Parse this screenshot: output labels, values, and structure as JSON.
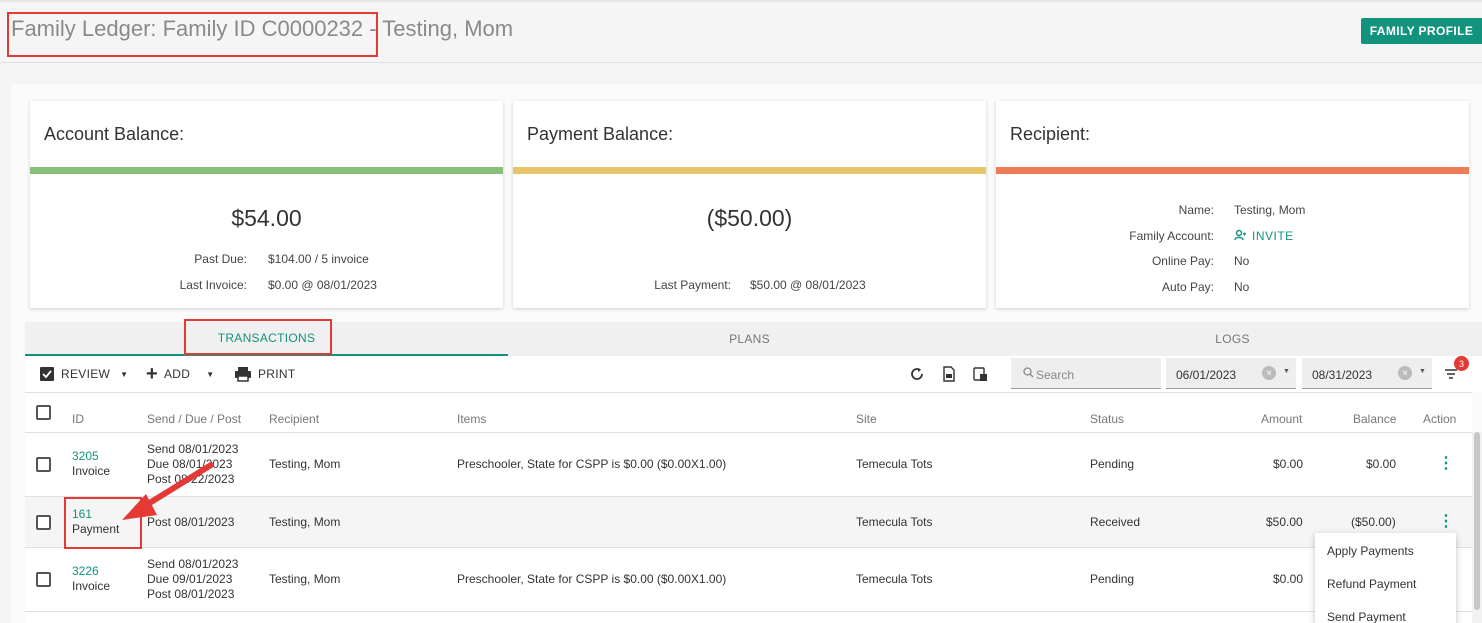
{
  "header": {
    "title": "Family Ledger: Family ID C0000232 - Testing, Mom",
    "family_profile_button": "FAMILY PROFILE"
  },
  "cards": {
    "account": {
      "title": "Account Balance:",
      "amount": "$54.00",
      "past_due_label": "Past Due:",
      "past_due_value": "$104.00  / 5 invoice",
      "last_invoice_label": "Last Invoice:",
      "last_invoice_value": "$0.00 @ 08/01/2023",
      "bar_color": "#88bf7d"
    },
    "payment": {
      "title": "Payment Balance:",
      "amount": "($50.00)",
      "last_payment_label": "Last Payment:",
      "last_payment_value": "$50.00 @ 08/01/2023",
      "bar_color": "#e8c46b"
    },
    "recipient": {
      "title": "Recipient:",
      "name_label": "Name:",
      "name_value": "Testing, Mom",
      "family_account_label": "Family Account:",
      "family_account_value": "INVITE",
      "online_pay_label": "Online Pay:",
      "online_pay_value": "No",
      "auto_pay_label": "Auto Pay:",
      "auto_pay_value": "No",
      "bar_color": "#ec7d56"
    }
  },
  "tabs": [
    "TRANSACTIONS",
    "PLANS",
    "LOGS"
  ],
  "toolbar": {
    "review": "REVIEW",
    "add": "ADD",
    "print": "PRINT",
    "search_placeholder": "Search",
    "start_date": "06/01/2023",
    "end_date": "08/31/2023",
    "filter_count": "3"
  },
  "table": {
    "headers": {
      "id": "ID",
      "dates": "Send / Due / Post",
      "recipient": "Recipient",
      "items": "Items",
      "site": "Site",
      "status": "Status",
      "amount": "Amount",
      "balance": "Balance",
      "action": "Action"
    },
    "rows": [
      {
        "id": "3205",
        "type": "Invoice",
        "send": "Send 08/01/2023",
        "due": "Due 08/01/2023",
        "post": "Post 08/22/2023",
        "recipient": "Testing, Mom",
        "items": "Preschooler, State for CSPP is $0.00 ($0.00X1.00)",
        "site": "Temecula Tots",
        "status": "Pending",
        "amount": "$0.00",
        "balance": "$0.00"
      },
      {
        "id": "161",
        "type": "Payment",
        "post": "Post 08/01/2023",
        "recipient": "Testing, Mom",
        "items": "",
        "site": "Temecula Tots",
        "status": "Received",
        "amount": "$50.00",
        "balance": "($50.00)"
      },
      {
        "id": "3226",
        "type": "Invoice",
        "send": "Send 08/01/2023",
        "due": "Due 09/01/2023",
        "post": "Post 08/01/2023",
        "recipient": "Testing, Mom",
        "items": "Preschooler, State for CSPP is $0.00 ($0.00X1.00)",
        "site": "Temecula Tots",
        "status": "Pending",
        "amount": "$0.00",
        "balance": ""
      }
    ]
  },
  "action_menu": [
    "Apply Payments",
    "Refund Payment",
    "Send Payment"
  ],
  "colors": {
    "accent": "#12937d",
    "highlight": "#e53935"
  }
}
